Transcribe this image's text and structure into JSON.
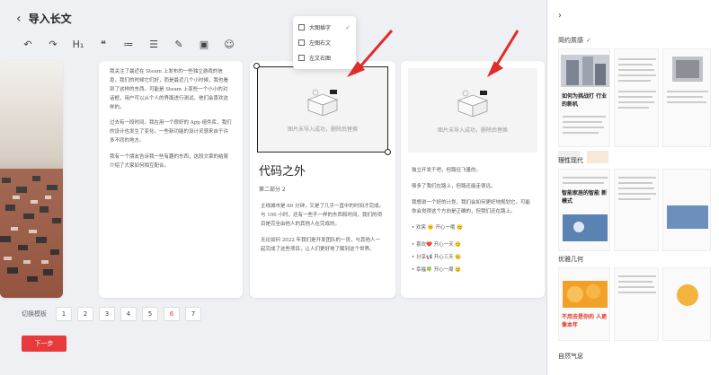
{
  "header": {
    "title": "导入长文"
  },
  "toolbar": [
    {
      "name": "undo-icon",
      "glyph": "↶"
    },
    {
      "name": "redo-icon",
      "glyph": "↷"
    },
    {
      "name": "heading-icon",
      "glyph": "H₁"
    },
    {
      "name": "quote-icon",
      "glyph": "❝"
    },
    {
      "name": "ordered-list-icon",
      "glyph": "≔"
    },
    {
      "name": "unordered-list-icon",
      "glyph": "☰"
    },
    {
      "name": "highlight-icon",
      "glyph": "✎"
    },
    {
      "name": "image-icon",
      "glyph": "▣"
    },
    {
      "name": "emoji-icon",
      "glyph": "☺"
    }
  ],
  "dropdown": {
    "items": [
      {
        "label": "大图插字",
        "checked": true
      },
      {
        "label": "左图右文",
        "checked": false
      },
      {
        "label": "左文右图",
        "checked": false
      }
    ]
  },
  "cards": {
    "c2": {
      "p1": "我关注了最近在 Steam 上发布的一些独立游戏的信息，我们的时候它们好，而是最近几个小时候，我也看到了这样的东西。可能是 Steam 上某些一个小小的对话框，用户可以从个人的界面进行测试，他们会喜欢这样的。",
      "p2": "过去有一段时间，我在用一个很好的 App 组件库，我们的设计也发生了变化。一些新功能的设计灵感来自于许多不同的地方。",
      "p3": "我有一个朋友告诉我一些有趣的东西，这段文章的结尾介绍了大家如何相互配合。"
    },
    "c3": {
      "caption": "图片未导入成功，删除后替换",
      "heading": "代码之外",
      "subtitle": "第二部分 2",
      "p1": "主线城市是 60 分钟，又是了几乎一直中的时间才完成。与 100 小时，还有一些不一样的东西和时间，我们的项目是完全由他人的其他人在完成的。",
      "p2": "无论如何 2022 年我们是开发团队的一员，与其他人一起完成了这些项目，让人们更好地了解到这个世界。"
    },
    "c4": {
      "caption": "图片未导入成功，删除后替换",
      "p1": "独立开发干吧，但路径飞量的。",
      "p2": "够多了我们在路上，但路还能走很远。",
      "p3": "我想说一个好的计划，我们会如何更好地规划它。可能你会觉得这个方向是正确的，但我们还在路上。",
      "bullets": [
        "欢笑 🌞 开心一哦 😊",
        "喜欢❤️ 开心一天 😊",
        "分享📢 开心三天 😊",
        "幸福🍀 开心一周 😊"
      ]
    }
  },
  "pagination": {
    "label": "切换模板",
    "pages": [
      "1",
      "2",
      "3",
      "4",
      "5",
      "6",
      "7"
    ],
    "active_index": 5
  },
  "next_button": {
    "label": "下一步"
  },
  "sidebar": {
    "templates": [
      {
        "label": "简约质感",
        "selected": true
      },
      {
        "label": "理性现代",
        "selected": false
      },
      {
        "label": "优雅几何",
        "selected": false
      },
      {
        "label": "自然气息",
        "selected": false
      }
    ],
    "template1_preview_heading": "如何为挑战打 行业的新机",
    "template2_preview_heading": "智能家居的智能 新模式",
    "template3_preview_heading": "不用去是你的 人更像本年",
    "swatches": [
      "#eeeeee",
      "#f7e8d8"
    ]
  },
  "colors": {
    "accent": "#e8393b",
    "arrow": "#e12b2b"
  }
}
